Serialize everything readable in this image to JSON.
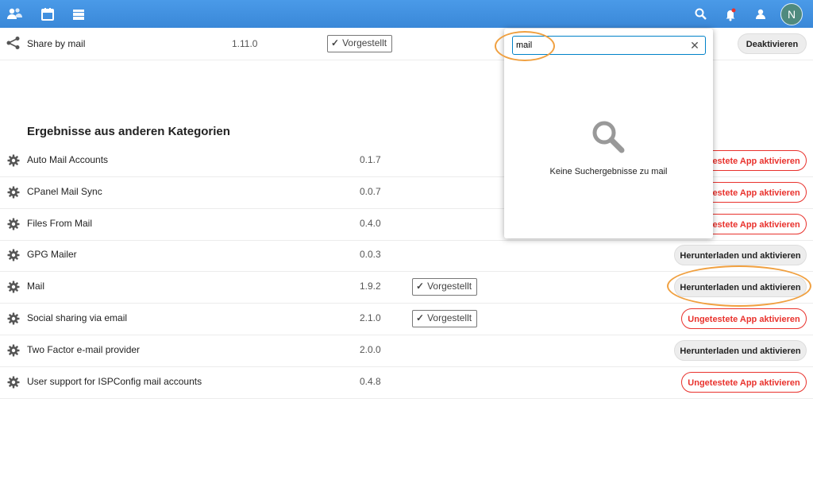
{
  "topbar": {
    "icons": [
      "contacts-icon",
      "calendar-icon",
      "files-icon"
    ],
    "right_icons": [
      "search-icon",
      "notifications-icon",
      "contacts-menu-icon"
    ],
    "avatar_letter": "N"
  },
  "featured_app": {
    "name": "Share by mail",
    "version": "1.11.0",
    "tag": "Vorgestellt",
    "button": "Deaktivieren"
  },
  "section_title": "Ergebnisse aus anderen Kategorien",
  "apps": [
    {
      "name": "Auto Mail Accounts",
      "version": "0.1.7",
      "tag": "",
      "button": "Ungetestete App aktivieren",
      "button_style": "red"
    },
    {
      "name": "CPanel Mail Sync",
      "version": "0.0.7",
      "tag": "",
      "button": "Ungetestete App aktivieren",
      "button_style": "red"
    },
    {
      "name": "Files From Mail",
      "version": "0.4.0",
      "tag": "",
      "button": "Ungetestete App aktivieren",
      "button_style": "red"
    },
    {
      "name": "GPG Mailer",
      "version": "0.0.3",
      "tag": "",
      "button": "Herunterladen und aktivieren",
      "button_style": "grey"
    },
    {
      "name": "Mail",
      "version": "1.9.2",
      "tag": "Vorgestellt",
      "button": "Herunterladen und aktivieren",
      "button_style": "grey"
    },
    {
      "name": "Social sharing via email",
      "version": "2.1.0",
      "tag": "Vorgestellt",
      "button": "Ungetestete App aktivieren",
      "button_style": "red"
    },
    {
      "name": "Two Factor e-mail provider",
      "version": "2.0.0",
      "tag": "",
      "button": "Herunterladen und aktivieren",
      "button_style": "grey"
    },
    {
      "name": "User support for ISPConfig mail accounts",
      "version": "0.4.8",
      "tag": "",
      "button": "Ungetestete App aktivieren",
      "button_style": "red"
    }
  ],
  "search_popup": {
    "query": "mail",
    "empty_text": "Keine Suchergebnisse zu mail"
  },
  "colors": {
    "header": "#3a88d8",
    "danger": "#e9322d",
    "highlight": "#f0a040"
  }
}
